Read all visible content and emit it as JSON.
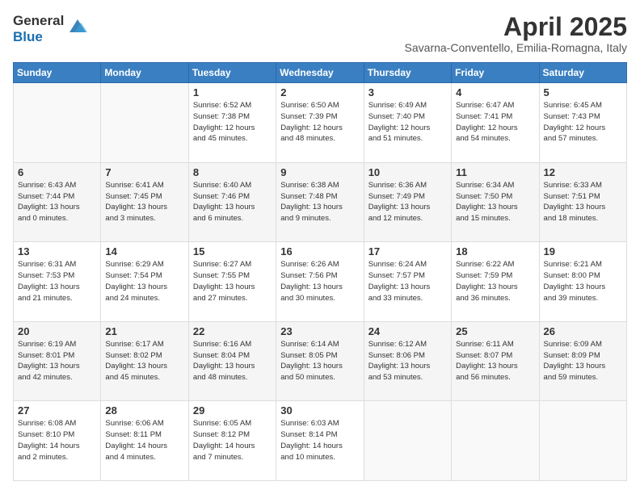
{
  "header": {
    "logo": {
      "line1": "General",
      "line2": "Blue"
    },
    "title": "April 2025",
    "location": "Savarna-Conventello, Emilia-Romagna, Italy"
  },
  "weekdays": [
    "Sunday",
    "Monday",
    "Tuesday",
    "Wednesday",
    "Thursday",
    "Friday",
    "Saturday"
  ],
  "weeks": [
    [
      {
        "day": "",
        "info": ""
      },
      {
        "day": "",
        "info": ""
      },
      {
        "day": "1",
        "info": "Sunrise: 6:52 AM\nSunset: 7:38 PM\nDaylight: 12 hours\nand 45 minutes."
      },
      {
        "day": "2",
        "info": "Sunrise: 6:50 AM\nSunset: 7:39 PM\nDaylight: 12 hours\nand 48 minutes."
      },
      {
        "day": "3",
        "info": "Sunrise: 6:49 AM\nSunset: 7:40 PM\nDaylight: 12 hours\nand 51 minutes."
      },
      {
        "day": "4",
        "info": "Sunrise: 6:47 AM\nSunset: 7:41 PM\nDaylight: 12 hours\nand 54 minutes."
      },
      {
        "day": "5",
        "info": "Sunrise: 6:45 AM\nSunset: 7:43 PM\nDaylight: 12 hours\nand 57 minutes."
      }
    ],
    [
      {
        "day": "6",
        "info": "Sunrise: 6:43 AM\nSunset: 7:44 PM\nDaylight: 13 hours\nand 0 minutes."
      },
      {
        "day": "7",
        "info": "Sunrise: 6:41 AM\nSunset: 7:45 PM\nDaylight: 13 hours\nand 3 minutes."
      },
      {
        "day": "8",
        "info": "Sunrise: 6:40 AM\nSunset: 7:46 PM\nDaylight: 13 hours\nand 6 minutes."
      },
      {
        "day": "9",
        "info": "Sunrise: 6:38 AM\nSunset: 7:48 PM\nDaylight: 13 hours\nand 9 minutes."
      },
      {
        "day": "10",
        "info": "Sunrise: 6:36 AM\nSunset: 7:49 PM\nDaylight: 13 hours\nand 12 minutes."
      },
      {
        "day": "11",
        "info": "Sunrise: 6:34 AM\nSunset: 7:50 PM\nDaylight: 13 hours\nand 15 minutes."
      },
      {
        "day": "12",
        "info": "Sunrise: 6:33 AM\nSunset: 7:51 PM\nDaylight: 13 hours\nand 18 minutes."
      }
    ],
    [
      {
        "day": "13",
        "info": "Sunrise: 6:31 AM\nSunset: 7:53 PM\nDaylight: 13 hours\nand 21 minutes."
      },
      {
        "day": "14",
        "info": "Sunrise: 6:29 AM\nSunset: 7:54 PM\nDaylight: 13 hours\nand 24 minutes."
      },
      {
        "day": "15",
        "info": "Sunrise: 6:27 AM\nSunset: 7:55 PM\nDaylight: 13 hours\nand 27 minutes."
      },
      {
        "day": "16",
        "info": "Sunrise: 6:26 AM\nSunset: 7:56 PM\nDaylight: 13 hours\nand 30 minutes."
      },
      {
        "day": "17",
        "info": "Sunrise: 6:24 AM\nSunset: 7:57 PM\nDaylight: 13 hours\nand 33 minutes."
      },
      {
        "day": "18",
        "info": "Sunrise: 6:22 AM\nSunset: 7:59 PM\nDaylight: 13 hours\nand 36 minutes."
      },
      {
        "day": "19",
        "info": "Sunrise: 6:21 AM\nSunset: 8:00 PM\nDaylight: 13 hours\nand 39 minutes."
      }
    ],
    [
      {
        "day": "20",
        "info": "Sunrise: 6:19 AM\nSunset: 8:01 PM\nDaylight: 13 hours\nand 42 minutes."
      },
      {
        "day": "21",
        "info": "Sunrise: 6:17 AM\nSunset: 8:02 PM\nDaylight: 13 hours\nand 45 minutes."
      },
      {
        "day": "22",
        "info": "Sunrise: 6:16 AM\nSunset: 8:04 PM\nDaylight: 13 hours\nand 48 minutes."
      },
      {
        "day": "23",
        "info": "Sunrise: 6:14 AM\nSunset: 8:05 PM\nDaylight: 13 hours\nand 50 minutes."
      },
      {
        "day": "24",
        "info": "Sunrise: 6:12 AM\nSunset: 8:06 PM\nDaylight: 13 hours\nand 53 minutes."
      },
      {
        "day": "25",
        "info": "Sunrise: 6:11 AM\nSunset: 8:07 PM\nDaylight: 13 hours\nand 56 minutes."
      },
      {
        "day": "26",
        "info": "Sunrise: 6:09 AM\nSunset: 8:09 PM\nDaylight: 13 hours\nand 59 minutes."
      }
    ],
    [
      {
        "day": "27",
        "info": "Sunrise: 6:08 AM\nSunset: 8:10 PM\nDaylight: 14 hours\nand 2 minutes."
      },
      {
        "day": "28",
        "info": "Sunrise: 6:06 AM\nSunset: 8:11 PM\nDaylight: 14 hours\nand 4 minutes."
      },
      {
        "day": "29",
        "info": "Sunrise: 6:05 AM\nSunset: 8:12 PM\nDaylight: 14 hours\nand 7 minutes."
      },
      {
        "day": "30",
        "info": "Sunrise: 6:03 AM\nSunset: 8:14 PM\nDaylight: 14 hours\nand 10 minutes."
      },
      {
        "day": "",
        "info": ""
      },
      {
        "day": "",
        "info": ""
      },
      {
        "day": "",
        "info": ""
      }
    ]
  ]
}
